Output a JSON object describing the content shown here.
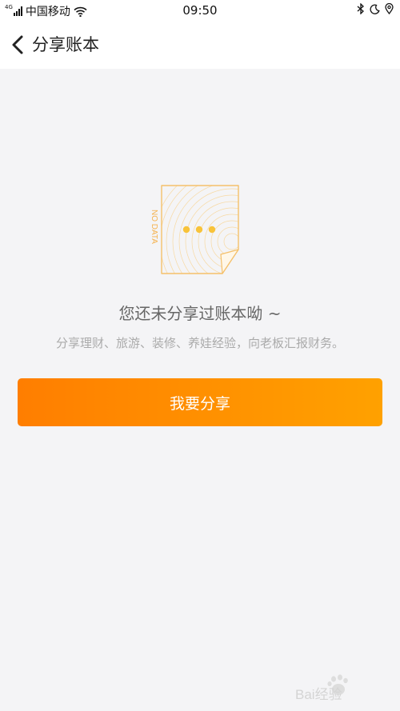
{
  "status_bar": {
    "network": "4G",
    "carrier": "中国移动",
    "time": "09:50"
  },
  "nav": {
    "title": "分享账本"
  },
  "empty_state": {
    "badge": "NO DATA",
    "title": "您还未分享过账本呦 ~",
    "description": "分享理财、旅游、装修、养娃经验，向老板汇报财务。"
  },
  "action": {
    "share_label": "我要分享"
  },
  "colors": {
    "accent_start": "#ff7e00",
    "accent_end": "#ffa100",
    "illustration": "#f5c06a"
  },
  "watermark": {
    "text": "Bai经验"
  }
}
